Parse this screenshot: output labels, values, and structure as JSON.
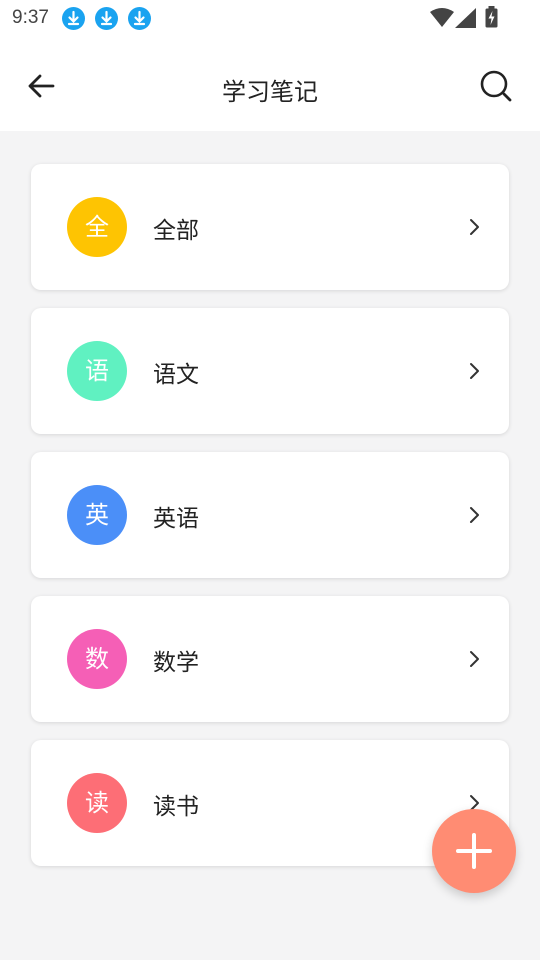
{
  "status": {
    "time": "9:37",
    "notification_icons": [
      "download-icon",
      "download-icon",
      "download-icon"
    ],
    "system_icons": [
      "wifi-icon",
      "cell-signal-icon",
      "battery-charging-icon"
    ]
  },
  "appbar": {
    "title": "学习笔记",
    "back_icon": "arrow-left-icon",
    "search_icon": "search-icon"
  },
  "categories": [
    {
      "badge": "全",
      "label": "全部",
      "color": "#fec402"
    },
    {
      "badge": "语",
      "label": "语文",
      "color": "#60f1c1"
    },
    {
      "badge": "英",
      "label": "英语",
      "color": "#4b8ff8"
    },
    {
      "badge": "数",
      "label": "数学",
      "color": "#f55fb6"
    },
    {
      "badge": "读",
      "label": "读书",
      "color": "#fd6e76"
    }
  ],
  "fab": {
    "icon": "plus-icon",
    "color": "#ff8c73"
  }
}
